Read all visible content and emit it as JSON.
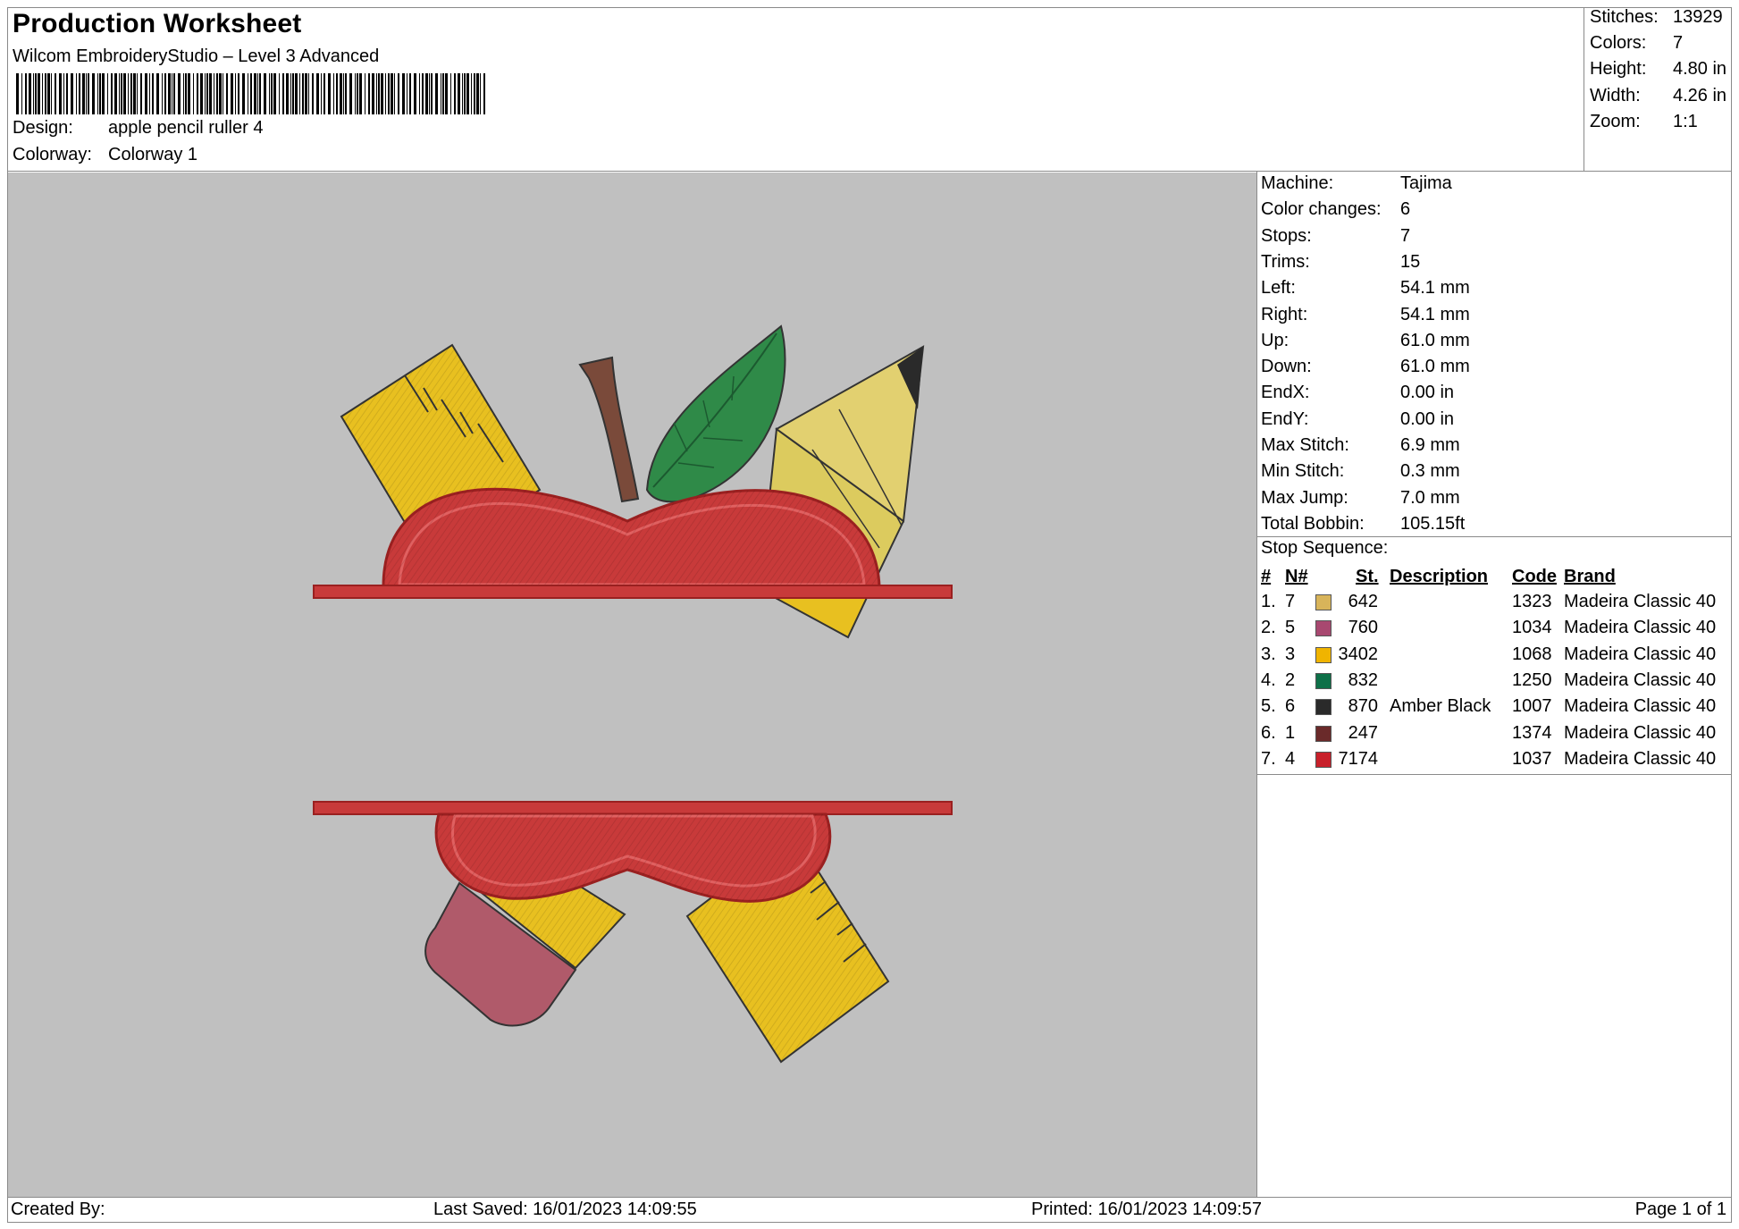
{
  "header": {
    "title": "Production Worksheet",
    "software": "Wilcom EmbroideryStudio – Level 3 Advanced",
    "design_label": "Design:",
    "design_value": "apple pencil ruller 4",
    "colorway_label": "Colorway:",
    "colorway_value": "Colorway 1"
  },
  "summary": {
    "stitches_label": "Stitches:",
    "stitches": "13929",
    "colors_label": "Colors:",
    "colors": "7",
    "height_label": "Height:",
    "height": "4.80 in",
    "width_label": "Width:",
    "width": "4.26 in",
    "zoom_label": "Zoom:",
    "zoom": "1:1"
  },
  "machine": [
    {
      "label": "Machine:",
      "value": "Tajima"
    },
    {
      "label": "Color changes:",
      "value": "6"
    },
    {
      "label": "Stops:",
      "value": "7"
    },
    {
      "label": "Trims:",
      "value": "15"
    },
    {
      "label": "Left:",
      "value": "54.1 mm"
    },
    {
      "label": "Right:",
      "value": "54.1 mm"
    },
    {
      "label": "Up:",
      "value": "61.0 mm"
    },
    {
      "label": "Down:",
      "value": "61.0 mm"
    },
    {
      "label": "EndX:",
      "value": "0.00 in"
    },
    {
      "label": "EndY:",
      "value": "0.00 in"
    },
    {
      "label": "Max Stitch:",
      "value": "6.9 mm"
    },
    {
      "label": "Min Stitch:",
      "value": "0.3 mm"
    },
    {
      "label": "Max Jump:",
      "value": "7.0 mm"
    },
    {
      "label": "Total Bobbin:",
      "value": "105.15ft"
    }
  ],
  "stop_sequence": {
    "title": "Stop Sequence:",
    "headers": {
      "idx": "#",
      "n": "N#",
      "st": "St.",
      "desc": "Description",
      "code": "Code",
      "brand": "Brand"
    },
    "rows": [
      {
        "idx": "1.",
        "n": "7",
        "color": "#d8b45a",
        "st": "642",
        "desc": "",
        "code": "1323",
        "brand": "Madeira Classic 40"
      },
      {
        "idx": "2.",
        "n": "5",
        "color": "#a84870",
        "st": "760",
        "desc": "",
        "code": "1034",
        "brand": "Madeira Classic 40"
      },
      {
        "idx": "3.",
        "n": "3",
        "color": "#f0b400",
        "st": "3402",
        "desc": "",
        "code": "1068",
        "brand": "Madeira Classic 40"
      },
      {
        "idx": "4.",
        "n": "2",
        "color": "#0e7048",
        "st": "832",
        "desc": "",
        "code": "1250",
        "brand": "Madeira Classic 40"
      },
      {
        "idx": "5.",
        "n": "6",
        "color": "#2a2a2a",
        "st": "870",
        "desc": "Amber Black",
        "code": "1007",
        "brand": "Madeira Classic 40"
      },
      {
        "idx": "6.",
        "n": "1",
        "color": "#6a2a2a",
        "st": "247",
        "desc": "",
        "code": "1374",
        "brand": "Madeira Classic 40"
      },
      {
        "idx": "7.",
        "n": "4",
        "color": "#c8202a",
        "st": "7174",
        "desc": "",
        "code": "1037",
        "brand": "Madeira Classic 40"
      }
    ]
  },
  "footer": {
    "created_by": "Created By:",
    "last_saved": "Last Saved: 16/01/2023 14:09:55",
    "printed": "Printed: 16/01/2023 14:09:57",
    "page": "Page 1 of 1"
  },
  "colors": {
    "canvas_bg": "#c0c0c0",
    "apple_red": "#c83a3a",
    "ruler_yellow": "#e8c020",
    "pencil_tan": "#dccb5e",
    "leaf_green": "#2f8a48",
    "stem_brown": "#7a4a3a",
    "eraser_pink": "#b05a6a"
  }
}
